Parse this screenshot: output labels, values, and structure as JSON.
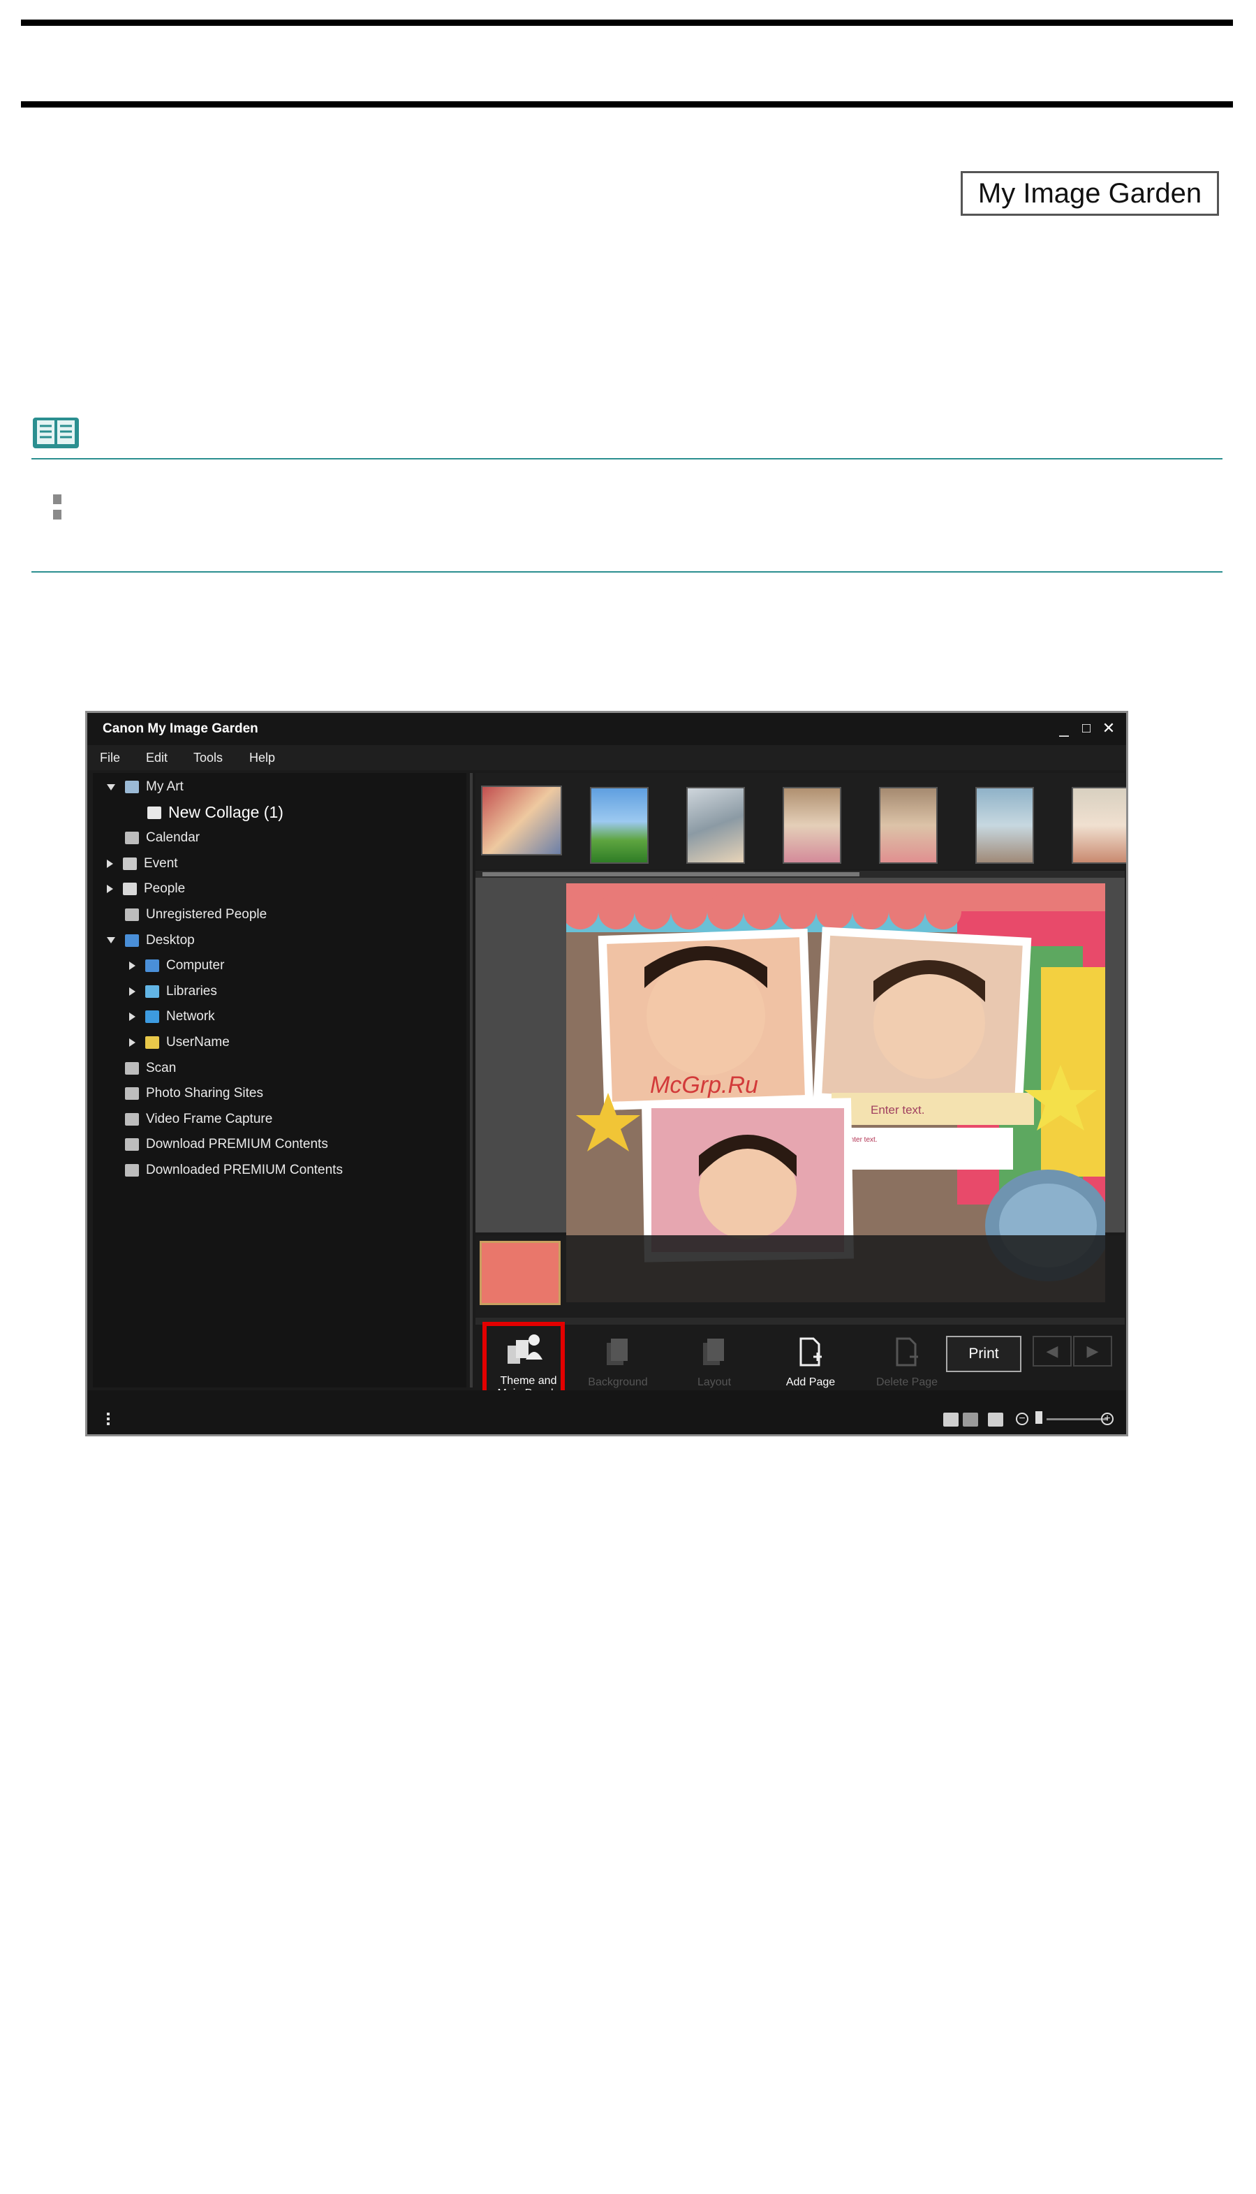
{
  "header": {
    "badge": "My Image Garden"
  },
  "app": {
    "title": "Canon My Image Garden",
    "window_buttons": {
      "minimize": "_",
      "maximize": "□",
      "close": "✕"
    },
    "menu": [
      "File",
      "Edit",
      "Tools",
      "Help"
    ],
    "tree": [
      {
        "label": "My Art",
        "icon": "my-art-icon",
        "expander": "down",
        "level": 0
      },
      {
        "label": "New Collage (1)",
        "icon": "collage-icon",
        "expander": "none",
        "level": 1,
        "selected": true
      },
      {
        "label": "Calendar",
        "icon": "calendar-icon",
        "expander": "none",
        "level": 0
      },
      {
        "label": "Event",
        "icon": "event-icon",
        "expander": "right",
        "level": 0
      },
      {
        "label": "People",
        "icon": "person-icon",
        "expander": "right",
        "level": 0
      },
      {
        "label": "Unregistered People",
        "icon": "unregistered-person-icon",
        "expander": "none",
        "level": 0
      },
      {
        "label": "Desktop",
        "icon": "desktop-icon",
        "expander": "down",
        "level": 0
      },
      {
        "label": "Computer",
        "icon": "computer-icon",
        "expander": "right",
        "level": 1
      },
      {
        "label": "Libraries",
        "icon": "libraries-icon",
        "expander": "right",
        "level": 1
      },
      {
        "label": "Network",
        "icon": "network-icon",
        "expander": "right",
        "level": 1
      },
      {
        "label": "UserName",
        "icon": "user-folder-icon",
        "expander": "right",
        "level": 1
      },
      {
        "label": "Scan",
        "icon": "scan-icon",
        "expander": "none",
        "level": 0
      },
      {
        "label": "Photo Sharing Sites",
        "icon": "photo-sharing-icon",
        "expander": "none",
        "level": 0
      },
      {
        "label": "Video Frame Capture",
        "icon": "video-frame-icon",
        "expander": "none",
        "level": 0
      },
      {
        "label": "Download PREMIUM Contents",
        "icon": "download-premium-icon",
        "expander": "none",
        "level": 0
      },
      {
        "label": "Downloaded PREMIUM Contents",
        "icon": "downloaded-premium-icon",
        "expander": "none",
        "level": 0
      }
    ],
    "canvas": {
      "enter_text": "Enter text.",
      "small_label": "Enter text.",
      "watermark": "McGrp.Ru"
    },
    "toolbar": {
      "theme": "Theme and Main People",
      "background": "Background",
      "layout": "Layout",
      "add_page": "Add Page",
      "delete_page": "Delete Page",
      "print": "Print"
    },
    "colors": {
      "highlight": "#e30000",
      "accent_teal": "#2b8f90"
    }
  }
}
